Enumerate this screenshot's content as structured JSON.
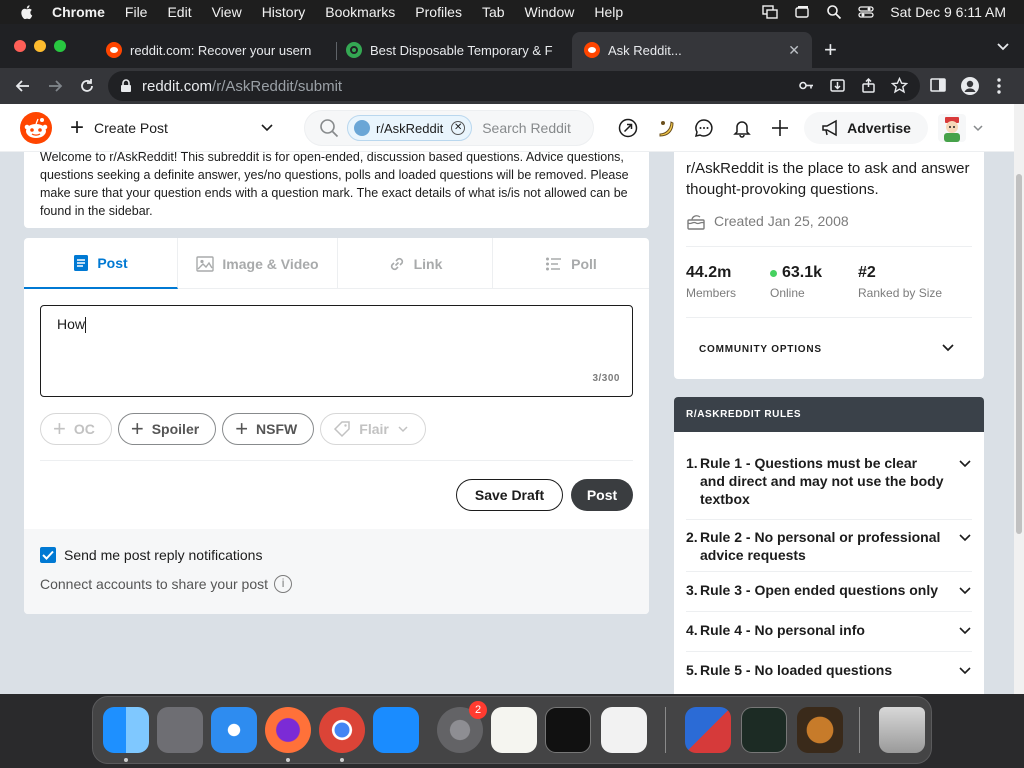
{
  "menubar": {
    "items": [
      "Chrome",
      "File",
      "Edit",
      "View",
      "History",
      "Bookmarks",
      "Profiles",
      "Tab",
      "Window",
      "Help"
    ],
    "clock": "Sat Dec 9  6:11 AM"
  },
  "browser": {
    "tabs": [
      {
        "title": "reddit.com: Recover your usern"
      },
      {
        "title": "Best Disposable Temporary & F"
      },
      {
        "title": "Ask Reddit..."
      }
    ],
    "url_host": "reddit.com",
    "url_path": "/r/AskReddit/submit"
  },
  "reddit_header": {
    "create_post": "Create Post",
    "community_chip": "r/AskReddit",
    "search_placeholder": "Search Reddit",
    "advertise": "Advertise"
  },
  "guidelines": {
    "text": "Welcome to r/AskReddit! This subreddit is for open-ended, discussion based questions. Advice questions, questions seeking a definite answer, yes/no questions, polls and loaded questions will be removed. Please make sure that your question ends with a question mark. The exact details of what is/is not allowed can be found in the sidebar."
  },
  "editor": {
    "tabs": [
      "Post",
      "Image & Video",
      "Link",
      "Poll"
    ],
    "title_value": "How",
    "char_count": "3/300",
    "tags": [
      "OC",
      "Spoiler",
      "NSFW",
      "Flair"
    ],
    "save_draft": "Save Draft",
    "post": "Post",
    "notifications_label": "Send me post reply notifications",
    "connect_label": "Connect accounts to share your post",
    "info_glyph": "i"
  },
  "about": {
    "description": "r/AskReddit is the place to ask and answer thought-provoking questions.",
    "created": "Created Jan 25, 2008",
    "members_value": "44.2m",
    "members_label": "Members",
    "online_value": "63.1k",
    "online_label": "Online",
    "rank_value": "#2",
    "rank_label": "Ranked by Size",
    "community_options": "COMMUNITY OPTIONS"
  },
  "rules": {
    "heading": "R/ASKREDDIT RULES",
    "items": [
      {
        "num": "1.",
        "text": "Rule 1 - Questions must be clear and direct and may not use the body textbox"
      },
      {
        "num": "2.",
        "text": "Rule 2 - No personal or professional advice requests"
      },
      {
        "num": "3.",
        "text": "Rule 3 - Open ended questions only"
      },
      {
        "num": "4.",
        "text": "Rule 4 - No personal info"
      },
      {
        "num": "5.",
        "text": "Rule 5 - No loaded questions"
      }
    ]
  },
  "dock": {
    "settings_badge": "2"
  },
  "colors": {
    "reddit_orange": "#ff4500",
    "reddit_blue": "#0079d3",
    "online_green": "#46d160"
  }
}
